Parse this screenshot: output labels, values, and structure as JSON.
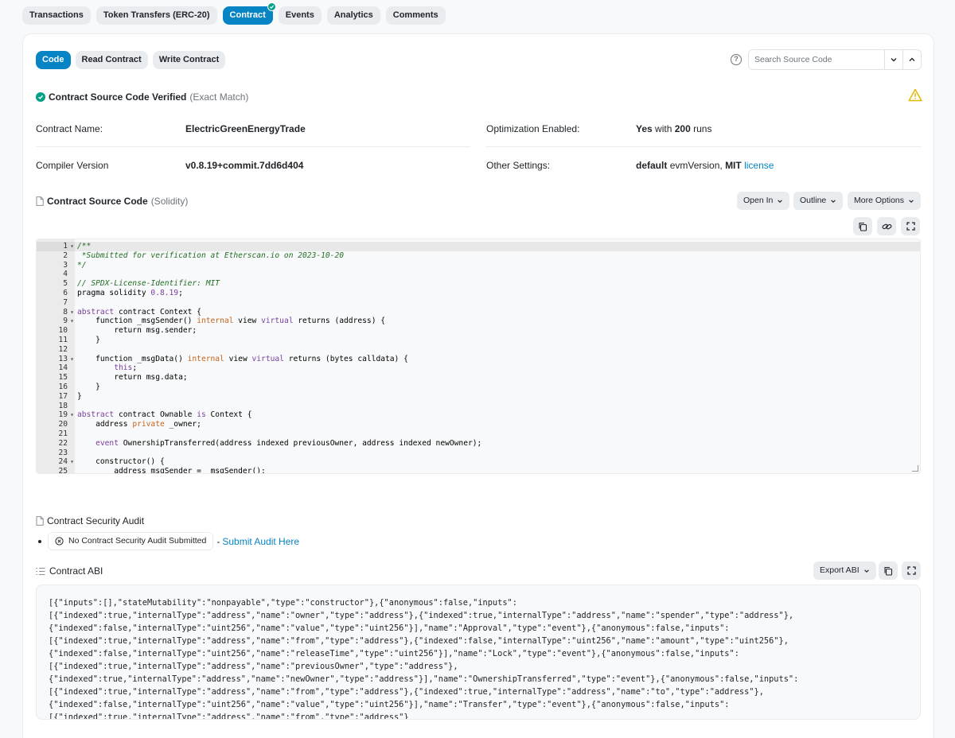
{
  "top_tabs": [
    "Transactions",
    "Token Transfers (ERC-20)",
    "Contract",
    "Events",
    "Analytics",
    "Comments"
  ],
  "sub_tabs": [
    "Code",
    "Read Contract",
    "Write Contract"
  ],
  "search": {
    "placeholder": "Search Source Code"
  },
  "verified": {
    "title": "Contract Source Code Verified",
    "match": "(Exact Match)"
  },
  "info": {
    "contract_name_label": "Contract Name:",
    "contract_name": "ElectricGreenEnergyTrade",
    "compiler_label": "Compiler Version",
    "compiler": "v0.8.19+commit.7dd6d404",
    "optimization_label": "Optimization Enabled:",
    "optimization_yes": "Yes",
    "optimization_with": "with",
    "optimization_runs": "200",
    "optimization_runs_word": "runs",
    "other_label": "Other Settings:",
    "other_default": "default",
    "other_evm": "evmVersion,",
    "other_mit": "MIT",
    "other_license": "license"
  },
  "source": {
    "title": "Contract Source Code",
    "lang": "(Solidity)",
    "open_in": "Open In",
    "outline": "Outline",
    "more_options": "More Options"
  },
  "code_lines": [
    "/**",
    " *Submitted for verification at Etherscan.io on 2023-10-20",
    "*/",
    "",
    "// SPDX-License-Identifier: MIT",
    "pragma solidity 0.8.19;",
    "",
    "abstract contract Context {",
    "    function _msgSender() internal view virtual returns (address) {",
    "        return msg.sender;",
    "    }",
    "",
    "    function _msgData() internal view virtual returns (bytes calldata) {",
    "        this;",
    "        return msg.data;",
    "    }",
    "}",
    "",
    "abstract contract Ownable is Context {",
    "    address private _owner;",
    "",
    "    event OwnershipTransferred(address indexed previousOwner, address indexed newOwner);",
    "",
    "    constructor() {",
    "        address msgSender = _msgSender();"
  ],
  "audit": {
    "title": "Contract Security Audit",
    "badge": "No Contract Security Audit Submitted",
    "dash": "-",
    "link": "Submit Audit Here"
  },
  "abi": {
    "title": "Contract ABI",
    "export": "Export ABI",
    "text": "[{\"inputs\":[],\"stateMutability\":\"nonpayable\",\"type\":\"constructor\"},{\"anonymous\":false,\"inputs\":\n[{\"indexed\":true,\"internalType\":\"address\",\"name\":\"owner\",\"type\":\"address\"},{\"indexed\":true,\"internalType\":\"address\",\"name\":\"spender\",\"type\":\"address\"},\n{\"indexed\":false,\"internalType\":\"uint256\",\"name\":\"value\",\"type\":\"uint256\"}],\"name\":\"Approval\",\"type\":\"event\"},{\"anonymous\":false,\"inputs\":\n[{\"indexed\":true,\"internalType\":\"address\",\"name\":\"from\",\"type\":\"address\"},{\"indexed\":false,\"internalType\":\"uint256\",\"name\":\"amount\",\"type\":\"uint256\"},\n{\"indexed\":false,\"internalType\":\"uint256\",\"name\":\"releaseTime\",\"type\":\"uint256\"}],\"name\":\"Lock\",\"type\":\"event\"},{\"anonymous\":false,\"inputs\":\n[{\"indexed\":true,\"internalType\":\"address\",\"name\":\"previousOwner\",\"type\":\"address\"},\n{\"indexed\":true,\"internalType\":\"address\",\"name\":\"newOwner\",\"type\":\"address\"}],\"name\":\"OwnershipTransferred\",\"type\":\"event\"},{\"anonymous\":false,\"inputs\":\n[{\"indexed\":true,\"internalType\":\"address\",\"name\":\"from\",\"type\":\"address\"},{\"indexed\":true,\"internalType\":\"address\",\"name\":\"to\",\"type\":\"address\"},\n{\"indexed\":false,\"internalType\":\"uint256\",\"name\":\"value\",\"type\":\"uint256\"}],\"name\":\"Transfer\",\"type\":\"event\"},{\"anonymous\":false,\"inputs\":\n[{\"indexed\":true,\"internalType\":\"address\",\"name\":\"from\",\"type\":\"address\"}"
  },
  "colors": {
    "accent": "#0784c3",
    "success": "#00a186",
    "warning": "#f1c40f"
  }
}
